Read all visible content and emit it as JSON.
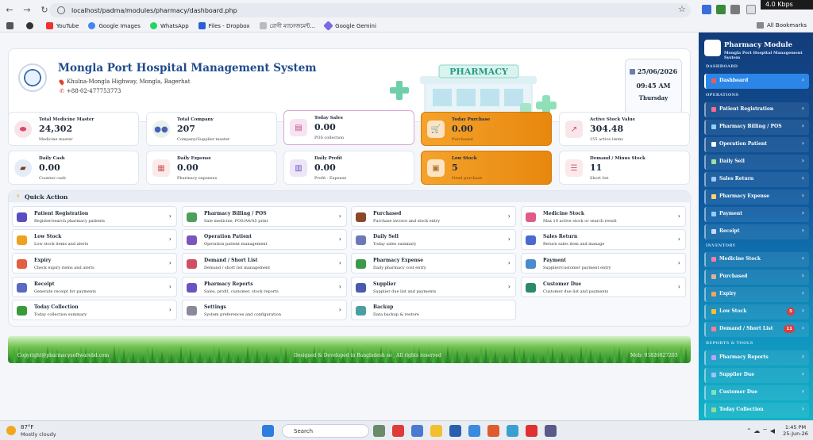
{
  "browser": {
    "url": "localhost/padma/modules/pharmacy/dashboard.php",
    "speed": "4.0 Kbps",
    "bookmarks": [
      "YouTube",
      "Google Images",
      "WhatsApp",
      "Files - Dropbox",
      "রোগী ম্যানেজমেন্ট...",
      "Google Gemini"
    ],
    "all_bookmarks": "All Bookmarks"
  },
  "header": {
    "title": "Mongla Port Hospital Management System",
    "address": "Khulna-Mongla Highway, Mongla, Bagerhat",
    "phone": "+88-02-477753773",
    "pharmacy_sign": "PHARMACY",
    "date": "25/06/2026",
    "time": "09:45 AM",
    "weekday": "Thursday"
  },
  "stats": [
    {
      "label": "Total Medicine Master",
      "value": "24,302",
      "sub": "Medicine master",
      "icon": "pill-icon",
      "color": "#f7e3ea",
      "fg": "#e0456a"
    },
    {
      "label": "Total Company",
      "value": "207",
      "sub": "Company/Supplier master",
      "icon": "users-icon",
      "color": "#e6f2ea",
      "fg": "#4a5fb5"
    },
    {
      "label": "Today Sales",
      "value": "0.00",
      "sub": "POS collection",
      "icon": "receipt-icon",
      "color": "#f6e4f0",
      "fg": "#c94b8a"
    },
    {
      "label": "Today Purchase",
      "value": "0.00",
      "sub": "Purchased",
      "icon": "cart-icon",
      "color": "#fbe3c3",
      "fg": "#c87a16"
    },
    {
      "label": "Active Stock Value",
      "value": "304.48",
      "sub": "155 active items",
      "icon": "chart-icon",
      "color": "#f8e6ea",
      "fg": "#d04a63"
    },
    {
      "label": "Daily Cash",
      "value": "0.00",
      "sub": "Counter cash",
      "icon": "wallet-icon",
      "color": "#e4ecf8",
      "fg": "#7a3a20"
    },
    {
      "label": "Daily Expense",
      "value": "0.00",
      "sub": "Pharmacy expenses",
      "icon": "document-icon",
      "color": "#fbeaea",
      "fg": "#d06060"
    },
    {
      "label": "Daily Profit",
      "value": "0.00",
      "sub": "Profit - Expense",
      "icon": "bar-chart-icon",
      "color": "#ece6f7",
      "fg": "#6a55c0"
    },
    {
      "label": "Low Stock",
      "value": "5",
      "sub": "Need purchase",
      "icon": "box-icon",
      "color": "#fbe3c3",
      "fg": "#b0712a"
    },
    {
      "label": "Demand / Minus Stock",
      "value": "11",
      "sub": "Short list",
      "icon": "list-icon",
      "color": "#fbe9ec",
      "fg": "#d06070"
    }
  ],
  "quick_action": {
    "title": "Quick Action",
    "items": [
      {
        "title": "Patient Registration",
        "sub": "Register/search pharmacy patients",
        "color": "#5a4fbf"
      },
      {
        "title": "Pharmacy Billing / POS",
        "sub": "Sale medicine, POS/A4/A5 print",
        "color": "#4ca05a"
      },
      {
        "title": "Purchased",
        "sub": "Purchase invoice and stock entry",
        "color": "#8a4a2a"
      },
      {
        "title": "Medicine Stock",
        "sub": "Max 10 active stock or search result",
        "color": "#e05a8a"
      },
      {
        "title": "Low Stock",
        "sub": "Low stock items and alerts",
        "color": "#f0a020"
      },
      {
        "title": "Operation Patient",
        "sub": "Operation patient management",
        "color": "#7a55c0"
      },
      {
        "title": "Daily Sell",
        "sub": "Today sales summary",
        "color": "#6a7ab8"
      },
      {
        "title": "Sales Return",
        "sub": "Return sales item and manage",
        "color": "#4a6ad0"
      },
      {
        "title": "Expiry",
        "sub": "Check expiry items and alerts",
        "color": "#e06040"
      },
      {
        "title": "Demand / Short List",
        "sub": "Demand / short list management",
        "color": "#d05060"
      },
      {
        "title": "Pharmacy Expense",
        "sub": "Daily pharmacy cost entry",
        "color": "#3a9a4a"
      },
      {
        "title": "Payment",
        "sub": "Supplier/customer payment entry",
        "color": "#4a8ad0"
      },
      {
        "title": "Receipt",
        "sub": "Generate receipt for payments",
        "color": "#5a6ac0"
      },
      {
        "title": "Pharmacy Reports",
        "sub": "Sales, profit, customer, stock reports",
        "color": "#6a55c0"
      },
      {
        "title": "Supplier",
        "sub": "Supplier due list and payments",
        "color": "#4a5ab0"
      },
      {
        "title": "Customer Due",
        "sub": "Customer due list and payments",
        "color": "#2a8a6a"
      },
      {
        "title": "Today Collection",
        "sub": "Today collection summary",
        "color": "#3a9a3a"
      },
      {
        "title": "Settings",
        "sub": "System preferences and configuration",
        "color": "#8a8a9a"
      },
      {
        "title": "Backup",
        "sub": "Data backup & restore",
        "color": "#4aa0a0"
      }
    ]
  },
  "footer": {
    "left": "Copyright@pharmacysoftwarebd.com",
    "center": "Designed & Developed in Bangladesh so , All rights reserved",
    "right": "Mob: 01826027203"
  },
  "sidebar": {
    "title": "Pharmacy Module",
    "subtitle": "Mongla Port Hospital Management System",
    "sections": {
      "dashboard": "DASHBOARD",
      "operations": "OPERATIONS",
      "inventory": "INVENTORY",
      "reports": "REPORTS & TOOLS"
    },
    "items": [
      {
        "label": "Dashboard",
        "active": true,
        "color": "#f05a5a"
      },
      {
        "label": "Patient Registration",
        "color": "#ff6b8a"
      },
      {
        "label": "Pharmacy Billing / POS",
        "color": "#8fd0ff"
      },
      {
        "label": "Operation Patient",
        "color": "#ffffff"
      },
      {
        "label": "Daily Sell",
        "color": "#9fe0a0"
      },
      {
        "label": "Sales Return",
        "color": "#9fc8ff"
      },
      {
        "label": "Pharmacy Expense",
        "color": "#ffd36a"
      },
      {
        "label": "Payment",
        "color": "#8fd0ff"
      },
      {
        "label": "Receipt",
        "color": "#d0d8ff"
      },
      {
        "label": "Medicine Stock",
        "color": "#ff7ab0"
      },
      {
        "label": "Purchased",
        "color": "#e0b090"
      },
      {
        "label": "Expiry",
        "color": "#ffa060"
      },
      {
        "label": "Low Stock",
        "color": "#ffc030",
        "badge": "5"
      },
      {
        "label": "Demand / Short List",
        "color": "#ff8090",
        "badge": "11"
      },
      {
        "label": "Pharmacy Reports",
        "color": "#c0a0ff"
      },
      {
        "label": "Supplier Due",
        "color": "#a0c0ff"
      },
      {
        "label": "Customer Due",
        "color": "#80e0c0"
      },
      {
        "label": "Today Collection",
        "color": "#90e090"
      }
    ]
  },
  "taskbar": {
    "temp": "87°F",
    "weather": "Mostly cloudy",
    "search": "Search",
    "time": "1:45 PM",
    "date": "25-Jun-26"
  }
}
